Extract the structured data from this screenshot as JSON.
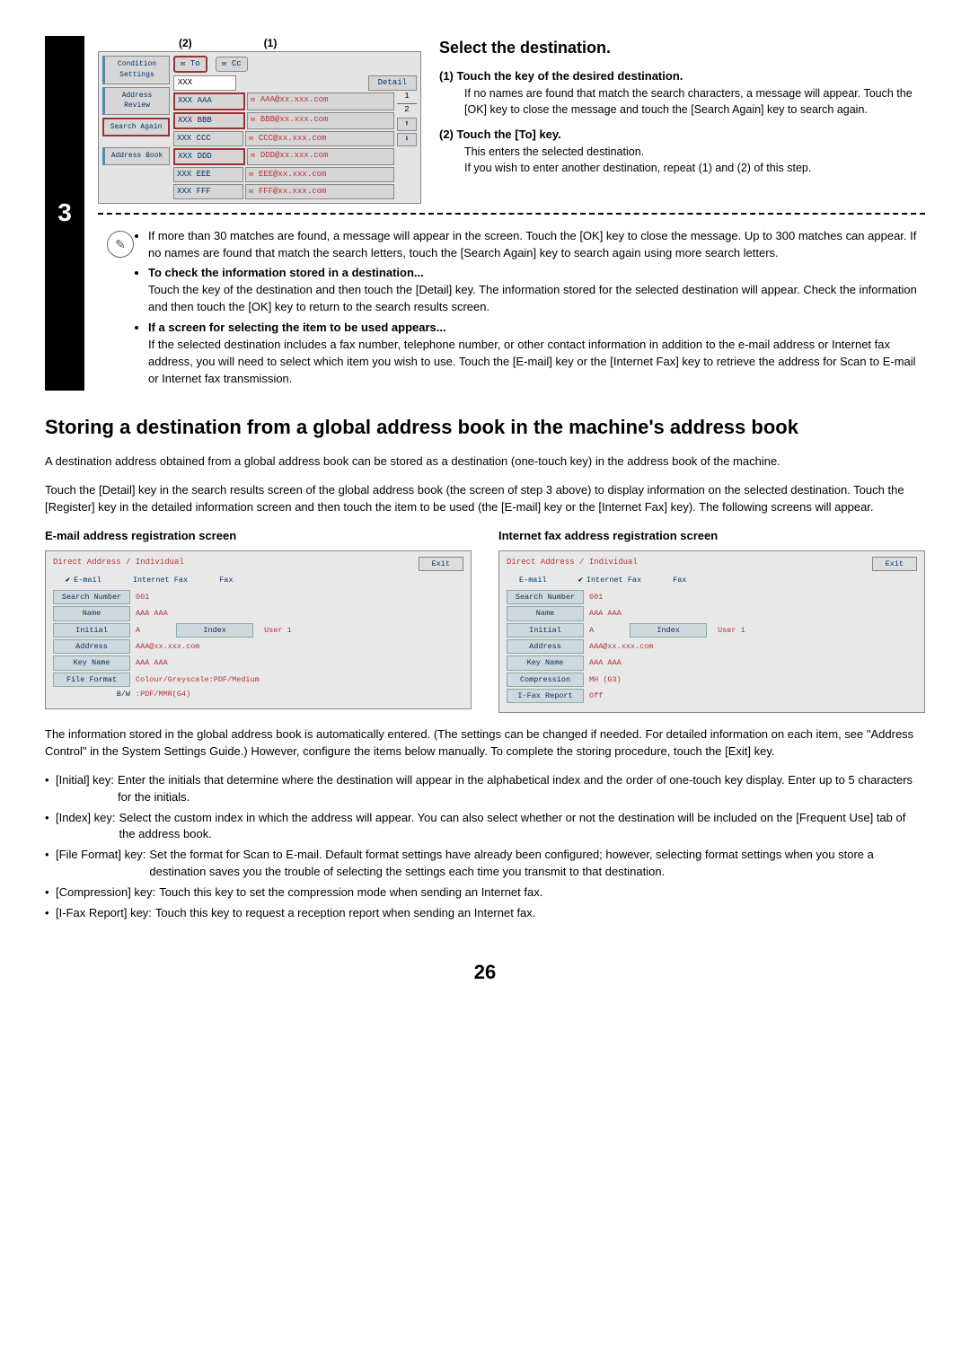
{
  "step": {
    "number": "3"
  },
  "scr1": {
    "callout1": "(2)",
    "callout2": "(1)",
    "left_tabs": {
      "condition": "Condition Settings",
      "review": "Address Review",
      "search": "Search Again",
      "book": "Address Book"
    },
    "top": {
      "to": "To",
      "cc": "Cc",
      "txt": "XXX",
      "detail": "Detail"
    },
    "rows": [
      {
        "n": "XXX AAA",
        "m": "AAA@xx.xxx.com"
      },
      {
        "n": "XXX BBB",
        "m": "BBB@xx.xxx.com"
      },
      {
        "n": "XXX CCC",
        "m": "CCC@xx.xxx.com"
      },
      {
        "n": "XXX DDD",
        "m": "DDD@xx.xxx.com"
      },
      {
        "n": "XXX EEE",
        "m": "EEE@xx.xxx.com"
      },
      {
        "n": "XXX FFF",
        "m": "FFF@xx.xxx.com"
      }
    ],
    "pager": {
      "num": "1",
      "den": "2",
      "up": "⬆",
      "down": "⬇"
    }
  },
  "instr": {
    "title": "Select the destination.",
    "s1": {
      "label": "(1)",
      "head": "Touch the key of the desired destination.",
      "body": "If no names are found that match the search characters, a message will appear. Touch the [OK] key to close the message and touch the [Search Again] key to search again."
    },
    "s2": {
      "label": "(2)",
      "head": "Touch the [To] key.",
      "body1": "This enters the selected destination.",
      "body2": "If you wish to enter another destination, repeat (1) and (2) of this step."
    }
  },
  "notes": {
    "n1": "If more than 30 matches are found, a message will appear in the screen. Touch the [OK] key to close the message. Up to 300 matches can appear. If no names are found that match the search letters, touch the [Search Again] key to search again using more search letters.",
    "n2h": "To check the information stored in a destination...",
    "n2": "Touch the key of the destination and then touch the [Detail] key. The information stored for the selected destination will appear. Check the information and then touch the [OK] key to return to the search results screen.",
    "n3h": "If a screen for selecting the item to be used appears...",
    "n3": "If the selected destination includes a fax number, telephone number, or other contact information in addition to the e-mail address or Internet fax address, you will need to select which item you wish to use. Touch the [E-mail] key or the [Internet Fax] key to retrieve the address for Scan to E-mail or Internet fax transmission."
  },
  "storing": {
    "title": "Storing a destination from a global address book in the machine's address book",
    "p1": "A destination address obtained from a global address book can be stored as a destination (one-touch key) in the address book of the machine.",
    "p2": "Touch the [Detail] key in the search results screen of the global address book (the screen of step 3 above) to display information on the selected destination. Touch the [Register] key in the detailed information screen and then touch the item to be used (the [E-mail] key or the [Internet Fax] key). The following screens will appear."
  },
  "reg_email": {
    "title": "E-mail address registration screen",
    "crumb": "Direct Address / Individual",
    "exit": "Exit",
    "tabs": {
      "email": "E-mail",
      "ifax": "Internet Fax",
      "fax": "Fax"
    },
    "rows": {
      "search": {
        "l": "Search Number",
        "v": "001"
      },
      "name": {
        "l": "Name",
        "v": "AAA AAA"
      },
      "initial": {
        "l": "Initial",
        "v": "A",
        "idx_l": "Index",
        "idx_v": "User 1"
      },
      "address": {
        "l": "Address",
        "v": "AAA@xx.xxx.com"
      },
      "keyname": {
        "l": "Key Name",
        "v": "AAA AAA"
      },
      "format": {
        "l": "File Format",
        "v": "Colour/Greyscale:PDF/Medium"
      },
      "bw": {
        "l": "B/W",
        "v": ":PDF/MMR(G4)"
      }
    }
  },
  "reg_ifax": {
    "title": "Internet fax address registration screen",
    "crumb": "Direct Address / Individual",
    "exit": "Exit",
    "tabs": {
      "email": "E-mail",
      "ifax": "Internet Fax",
      "fax": "Fax"
    },
    "rows": {
      "search": {
        "l": "Search Number",
        "v": "001"
      },
      "name": {
        "l": "Name",
        "v": "AAA AAA"
      },
      "initial": {
        "l": "Initial",
        "v": "A",
        "idx_l": "Index",
        "idx_v": "User 1"
      },
      "address": {
        "l": "Address",
        "v": "AAA@xx.xxx.com"
      },
      "keyname": {
        "l": "Key Name",
        "v": "AAA AAA"
      },
      "comp": {
        "l": "Compression",
        "v": "MH (G3)"
      },
      "report": {
        "l": "I-Fax Report",
        "v": "Off"
      }
    }
  },
  "after": "The information stored in the global address book is automatically entered. (The settings can be changed if needed. For detailed information on each item, see \"Address Control\" in the System Settings Guide.) However, configure the items below manually. To complete the storing procedure, touch the [Exit] key.",
  "keys": {
    "initial": {
      "l": "[Initial] key:",
      "t": "Enter the initials that determine where the destination will appear in the alphabetical index and the order of one-touch key display. Enter up to 5 characters for the initials."
    },
    "index": {
      "l": "[Index] key:",
      "t": "Select the custom index in which the address will appear. You can also select whether or not the destination will be included on the [Frequent Use] tab of the address book."
    },
    "format": {
      "l": "[File Format] key:",
      "t": "Set the format for Scan to E-mail. Default format settings have already been configured; however, selecting format settings when you store a destination saves you the trouble of selecting the settings each time you transmit to that destination."
    },
    "comp": {
      "l": "[Compression] key:",
      "t": "Touch this key to set the compression mode when sending an Internet fax."
    },
    "report": {
      "l": "[I-Fax Report] key:",
      "t": "Touch this key to request a reception report when sending an Internet fax."
    }
  },
  "page": "26"
}
